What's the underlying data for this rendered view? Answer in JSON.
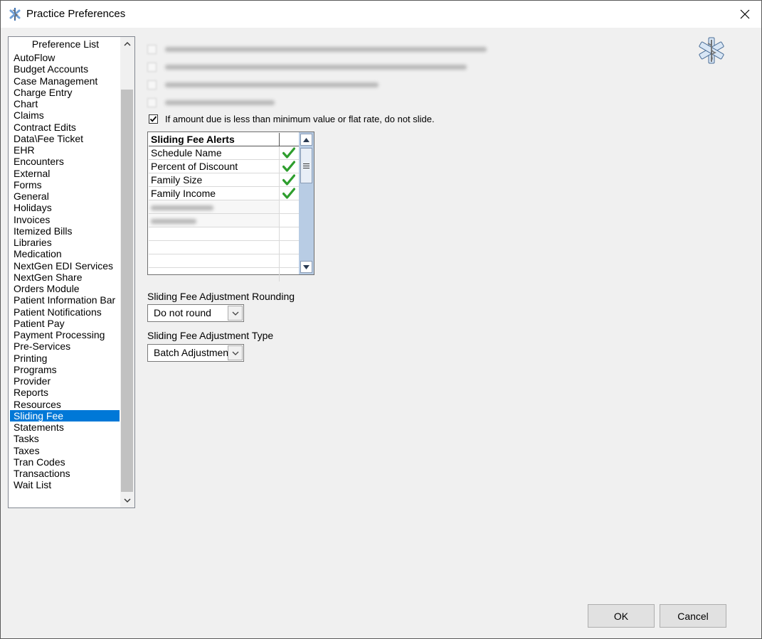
{
  "window": {
    "title": "Practice Preferences"
  },
  "pref_list": {
    "header": "Preference List",
    "items": [
      "AutoFlow",
      "Budget Accounts",
      "Case Management",
      "Charge Entry",
      "Chart",
      "Claims",
      "Contract Edits",
      "Data\\Fee Ticket",
      "EHR",
      "Encounters",
      "External",
      "Forms",
      "General",
      "Holidays",
      "Invoices",
      "Itemized Bills",
      "Libraries",
      "Medication",
      "NextGen EDI Services",
      "NextGen Share",
      "Orders Module",
      "Patient Information Bar",
      "Patient Notifications",
      "Patient Pay",
      "Payment Processing",
      "Pre-Services",
      "Printing",
      "Programs",
      "Provider",
      "Reports",
      "Resources",
      "Sliding Fee",
      "Statements",
      "Tasks",
      "Taxes",
      "Tran Codes",
      "Transactions",
      "Wait List"
    ],
    "selected": "Sliding Fee"
  },
  "options": {
    "min_value_label": "If amount due is less than minimum value or flat rate, do not slide.",
    "min_value_checked": true
  },
  "alerts_grid": {
    "header": "Sliding Fee Alerts",
    "rows": [
      {
        "name": "Schedule Name",
        "checked": true
      },
      {
        "name": "Percent of Discount",
        "checked": true
      },
      {
        "name": "Family Size",
        "checked": true
      },
      {
        "name": "Family Income",
        "checked": true
      }
    ]
  },
  "rounding": {
    "label": "Sliding Fee Adjustment Rounding",
    "value": "Do not round"
  },
  "adjustment_type": {
    "label": "Sliding Fee Adjustment Type",
    "value": "Batch Adjustment"
  },
  "buttons": {
    "ok": "OK",
    "cancel": "Cancel"
  },
  "colors": {
    "selection": "#0078d7",
    "check_green": "#2e9e2e"
  }
}
